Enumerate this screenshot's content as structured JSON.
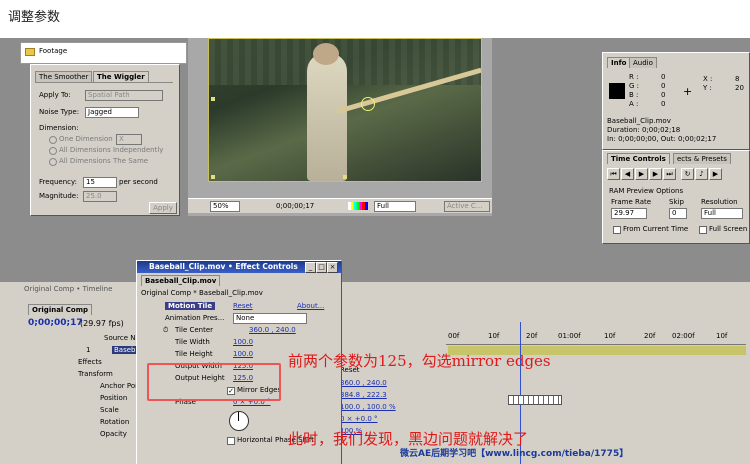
{
  "page_title": "调整参数",
  "project": {
    "footage": "Footage"
  },
  "wiggler": {
    "tabs": [
      "The Smoother",
      "The Wiggler"
    ],
    "apply_to_label": "Apply To:",
    "apply_to_value": "Spatial Path",
    "noise_type_label": "Noise Type:",
    "noise_type_value": "Jagged",
    "dimension_label": "Dimension:",
    "one_dimension": "One Dimension",
    "one_dimension_value": "X",
    "all_independent": "All Dimensions Independently",
    "all_same": "All Dimensions The Same",
    "frequency_label": "Frequency:",
    "frequency_value": "15",
    "per_second": "per second",
    "magnitude_label": "Magnitude:",
    "magnitude_value": "25.0",
    "apply_button": "Apply"
  },
  "comp_viewer": {
    "zoom": "50%",
    "timecode": "0;00;00;17",
    "resolution": "Full",
    "active_camera": "Active C..."
  },
  "info": {
    "tabs": [
      "Info",
      "Audio"
    ],
    "r_label": "R :",
    "g_label": "G :",
    "b_label": "B :",
    "a_label": "A :",
    "r": "0",
    "g": "0",
    "b": "0",
    "a": "0",
    "x_label": "X :",
    "y_label": "Y :",
    "x": "8",
    "y": "20",
    "file": "Baseball_Clip.mov",
    "duration": "Duration: 0;00;02;18",
    "in_out": "In: 0;00;00;00, Out: 0;00;02;17"
  },
  "time_controls": {
    "tabs": [
      "Time Controls",
      "ects & Presets"
    ],
    "ram_preview": "RAM Preview Options",
    "frame_rate_label": "Frame Rate",
    "frame_rate": "29.97",
    "skip_label": "Skip",
    "skip": "0",
    "resolution_label": "Resolution",
    "resolution": "Full",
    "from_current": "From Current Time",
    "full_screen": "Full Screen"
  },
  "effect_controls": {
    "title": "Baseball_Clip.mov • Effect Controls",
    "tab": "Baseball_Clip.mov",
    "breadcrumb": "Original Comp * Baseball_Clip.mov",
    "effect_name": "Motion Tile",
    "reset": "Reset",
    "about": "About...",
    "animation_presets_label": "Animation Pres...",
    "animation_presets_value": "None",
    "rows": [
      {
        "label": "Tile Center",
        "value": "360.0 , 240.0"
      },
      {
        "label": "Tile Width",
        "value": "100.0"
      },
      {
        "label": "Tile Height",
        "value": "100.0"
      },
      {
        "label": "Output Width",
        "value": "125.0"
      },
      {
        "label": "Output Height",
        "value": "125.0"
      }
    ],
    "mirror_edges": "Mirror Edges",
    "phase_label": "Phase",
    "phase_value": "0 × +0.0 °",
    "horizontal_phase_shift": "Horizontal Phase Shift"
  },
  "timeline": {
    "tab_top": "Original Comp • Timeline",
    "tab": "Original Comp",
    "timecode": "0;00;00;17",
    "fps": "(29.97 fps)",
    "source_name_header": "Source N",
    "layer_num": "1",
    "layer_name": "Baseb",
    "effects": "Effects",
    "transform": "Transform",
    "props": [
      "Anchor Poi",
      "Position",
      "Scale",
      "Rotation",
      "Opacity"
    ],
    "reset": "Reset",
    "position_value1": "360.0 , 240.0",
    "position_value2": "384.8 , 222.3",
    "scale_value": "100.0 , 100.0 %",
    "rotation_value": "0 × +0.0 °",
    "opacity_value": "100 %",
    "ticks": [
      "00f",
      "10f",
      "20f",
      "01:00f",
      "10f",
      "20f",
      "02:00f",
      "10f"
    ]
  },
  "annotations": {
    "line1": "前两个参数为125，勾选mirror edges",
    "line2": "此时，我们发现，黑边问题就解决了"
  },
  "watermark": "微云AE后期学习吧【www.lincg.com/tieba/1775】"
}
